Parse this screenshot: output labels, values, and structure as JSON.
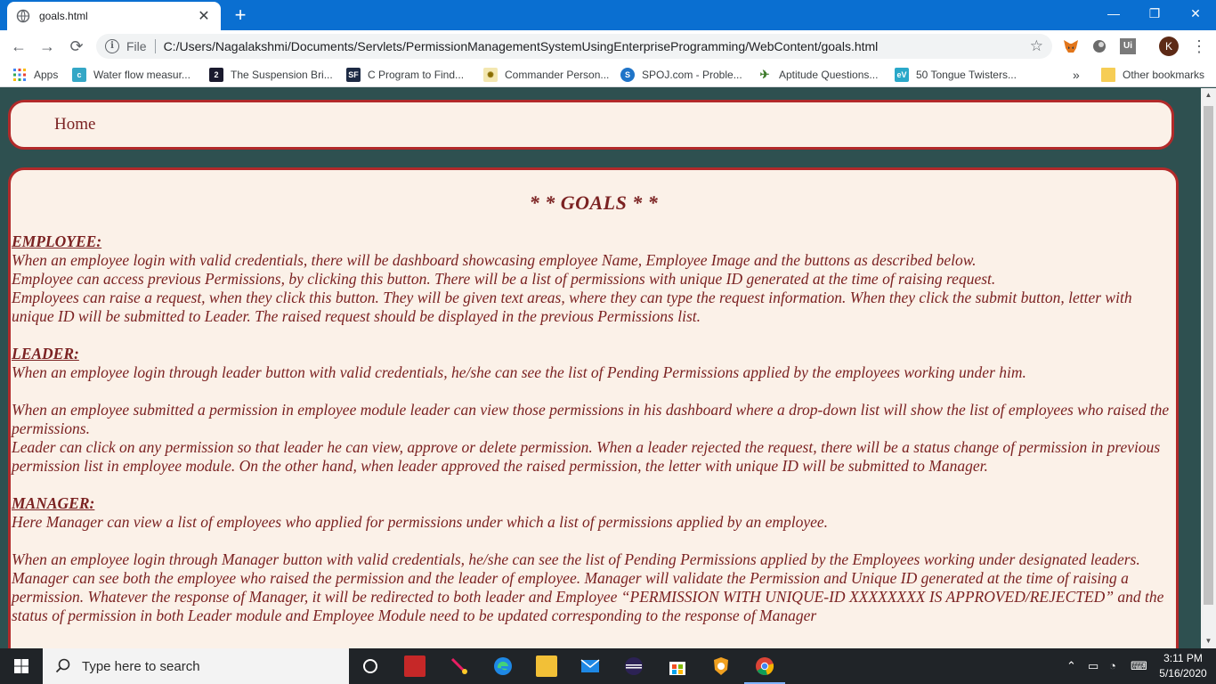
{
  "browser": {
    "tab_title": "goals.html",
    "new_tab": "+",
    "close_tab": "✕",
    "omnibox_scheme": "File",
    "url": "C:/Users/Nagalakshmi/Documents/Servlets/PermissionManagementSystemUsingEnterpriseProgramming/WebContent/goals.html",
    "profile_initial": "K",
    "window": {
      "minimize": "—",
      "restore": "❐",
      "close": "✕"
    }
  },
  "bookmarks": [
    {
      "label": "Apps",
      "icon": "apps-grid-icon",
      "color": "#e94235"
    },
    {
      "label": "Water flow measur...",
      "icon": "favicon-c4u",
      "color": "#34a7c6"
    },
    {
      "label": "The Suspension Bri...",
      "icon": "favicon-2",
      "color": "#1a1a2e"
    },
    {
      "label": "C Program to Find...",
      "icon": "favicon-sf",
      "color": "#1d2a44"
    },
    {
      "label": "Commander Person...",
      "icon": "favicon-commander",
      "color": "#c9a227"
    },
    {
      "label": "SPOJ.com - Proble...",
      "icon": "favicon-spoj",
      "color": "#1f74c8"
    },
    {
      "label": "Aptitude Questions...",
      "icon": "favicon-aptitude",
      "color": "#3d7a2a"
    },
    {
      "label": "50 Tongue Twisters...",
      "icon": "favicon-ev",
      "color": "#2aa8c9"
    }
  ],
  "bookmarks_overflow": "»",
  "other_bookmarks": "Other bookmarks",
  "nav": {
    "home": "Home"
  },
  "goals": {
    "title": "* * GOALS * *",
    "employee": {
      "heading": "EMPLOYEE:",
      "lines": [
        "When an employee login with valid credentials, there will be dashboard showcasing employee Name, Employee Image and the buttons as described below.",
        "Employee can access previous Permissions, by clicking this button. There will be a list of permissions with unique ID generated at the time of raising request.",
        "Employees can raise a request, when they click this button. They will be given text areas, where they can type the request information. When they click the submit button, letter with unique ID will be submitted to Leader. The raised request should be displayed in the previous Permissions list."
      ]
    },
    "leader": {
      "heading": "LEADER:",
      "line1": "When an employee login through leader button with valid credentials, he/she can see the list of Pending Permissions applied by the employees working under him.",
      "line2": "When an employee submitted a permission in employee module leader can view those permissions in his dashboard where a drop-down list will show the list of employees who raised the permissions.",
      "line3": "Leader can click on any permission so that leader he can view, approve or delete permission. When a leader rejected the request, there will be a status change of permission in previous permission list in employee module. On the other hand, when leader approved the raised permission, the letter with unique ID will be submitted to Manager."
    },
    "manager": {
      "heading": "MANAGER:",
      "line1": "Here Manager can view a list of employees who applied for permissions under which a list of permissions applied by an employee.",
      "line2": "When an employee login through Manager button with valid credentials, he/she can see the list of Pending Permissions applied by the Employees working under designated leaders. Manager can see both the employee who raised the permission and the leader of employee. Manager will validate the Permission and Unique ID generated at the time of raising a permission. Whatever the response of Manager, it will be redirected to both leader and Employee “PERMISSION WITH UNIQUE-ID XXXXXXXX IS APPROVED/REJECTED” and the status of permission in both Leader module and Employee Module need to be updated corresponding to the response of Manager"
    }
  },
  "taskbar": {
    "search_placeholder": "Type here to search",
    "time": "3:11 PM",
    "date": "5/16/2020"
  },
  "colors": {
    "accent_border": "#b22a2a",
    "text": "#7b2222",
    "panel": "#fbf1e8",
    "page_bg": "#2e5050"
  }
}
